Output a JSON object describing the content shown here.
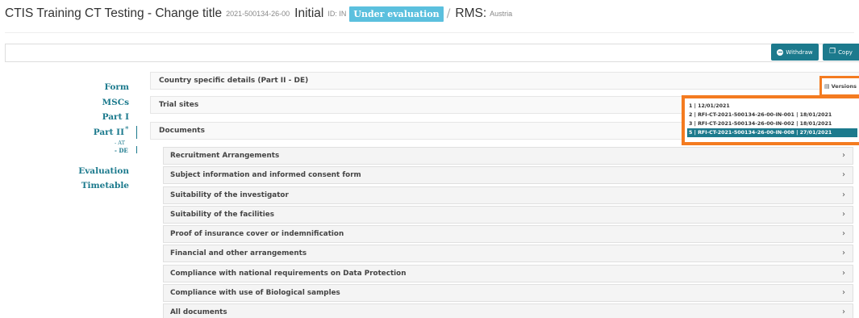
{
  "header": {
    "title": "CTIS Training CT Testing - Change title",
    "trial_number": "2021-500134-26-00",
    "phase": "Initial",
    "id_label": "ID: IN",
    "status_badge": "Under evaluation",
    "separator": "/",
    "rms_label": "RMS:",
    "rms_value": "Austria"
  },
  "toolbar": {
    "withdraw_label": "Withdraw",
    "copy_label": "Copy"
  },
  "sidebar": {
    "items": [
      {
        "label": "Form"
      },
      {
        "label": "MSCs"
      },
      {
        "label": "Part I"
      },
      {
        "label": "Part II"
      },
      {
        "label": "Evaluation"
      },
      {
        "label": "Timetable"
      }
    ],
    "part2_marker": "*",
    "sub_items": [
      {
        "label": "- AT"
      },
      {
        "label": "- DE"
      }
    ]
  },
  "main": {
    "sections": [
      {
        "title": "Country specific details (Part II - DE)"
      },
      {
        "title": "Trial sites"
      },
      {
        "title": "Documents"
      }
    ],
    "documents": [
      {
        "title": "Recruitment Arrangements"
      },
      {
        "title": "Subject information and informed consent form"
      },
      {
        "title": "Suitability of the investigator"
      },
      {
        "title": "Suitability of the facilities"
      },
      {
        "title": "Proof of insurance cover or indemnification"
      },
      {
        "title": "Financial and other arrangements"
      },
      {
        "title": "Compliance with national requirements on Data Protection"
      },
      {
        "title": "Compliance with use of Biological samples"
      },
      {
        "title": "All documents"
      }
    ],
    "chevron": "›"
  },
  "versions": {
    "button_label": "Versions",
    "items": [
      {
        "label": "1 | 12/01/2021"
      },
      {
        "label": "2 | RFI-CT-2021-500134-26-00-IN-001 | 18/01/2021"
      },
      {
        "label": "3 | RFI-CT-2021-500134-26-00-IN-002 | 18/01/2021"
      },
      {
        "label": "5 | RFI-CT-2021-500134-26-00-IN-008 | 27/01/2021"
      }
    ],
    "selected_index": 3
  },
  "colors": {
    "accent": "#1c7a8d",
    "badge": "#5bc0de",
    "highlight": "#f47b20"
  },
  "icons": {
    "withdraw": "minus-circle-icon",
    "copy": "copy-icon",
    "versions": "list-icon",
    "chevron": "chevron-right-icon"
  }
}
